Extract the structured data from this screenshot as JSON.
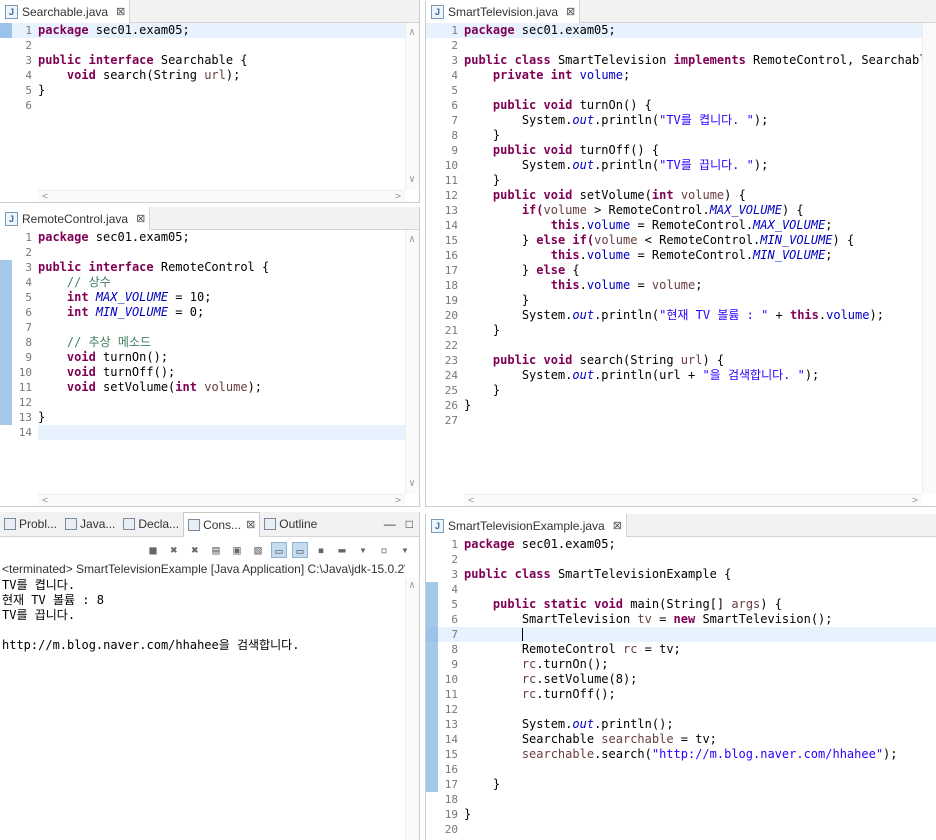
{
  "editors": {
    "searchable": {
      "tab": "Searchable.java",
      "lines": [
        "1",
        "2",
        "3",
        "4",
        "5",
        "6"
      ]
    },
    "remote": {
      "tab": "RemoteControl.java",
      "lines": [
        "1",
        "2",
        "3",
        "4",
        "5",
        "6",
        "7",
        "8",
        "9",
        "10",
        "11",
        "12",
        "13",
        "14"
      ]
    },
    "smarttv": {
      "tab": "SmartTelevision.java",
      "lines": [
        "1",
        "2",
        "3",
        "4",
        "5",
        "6",
        "7",
        "8",
        "9",
        "10",
        "11",
        "12",
        "13",
        "14",
        "15",
        "16",
        "17",
        "18",
        "19",
        "20",
        "21",
        "22",
        "23",
        "24",
        "25",
        "26",
        "27"
      ]
    },
    "example": {
      "tab": "SmartTelevisionExample.java",
      "lines": [
        "1",
        "2",
        "3",
        "4",
        "5",
        "6",
        "7",
        "8",
        "9",
        "10",
        "11",
        "12",
        "13",
        "14",
        "15",
        "16",
        "17",
        "18",
        "19",
        "20"
      ]
    }
  },
  "code": {
    "pkg": "package",
    "pkgname": " sec01.exam05;",
    "s3a": "public",
    "s3b": " ",
    "s3c": "interface",
    "s3d": " Searchable {",
    "s4a": "    ",
    "s4b": "void",
    "s4c": " search(String ",
    "s4d": "url",
    "s4e": ");",
    "s5": "}",
    "r3c": " RemoteControl {",
    "r4": "    // 상수",
    "r5a": "int",
    "r5b": "MAX_VOLUME",
    "r5c": " = 10;",
    "r6b": "MIN_VOLUME",
    "r6c": " = 0;",
    "r8": "    // 추상 메소드",
    "r9b": " turnOn();",
    "r10b": " turnOff();",
    "r11b": " setVolume(",
    "r11c": "volume",
    "r11d": ");",
    "t3b": "class",
    "t3c": " SmartTelevision ",
    "t3d": "implements",
    "t3e": " RemoteControl, Searchable {",
    "t4a": "private",
    "t4b": "int",
    "t4c": "volume",
    "t6b": "void",
    "t6c": " turnOn() {",
    "t7a": "System.",
    "t7b": "out",
    "t7c": ".println(",
    "t7d": "\"TV를 켭니다. \"",
    "t7e": ");",
    "t9c": " turnOff() {",
    "t10d": "\"TV를 끕니다. \"",
    "t12c": " setVolume(",
    "t12e": ") {",
    "t13a": "if(",
    "t13c": " > RemoteControl.",
    "t13e": ") {",
    "t14a": "this",
    "t14c": " = RemoteControl.",
    "t14e": ";",
    "t15a": "} ",
    "t15b": "else",
    "t15d": " < RemoteControl.",
    "t17b": " {",
    "t18d": ";",
    "t20d": "\"현재 TV 볼륨 : \"",
    "t20e": " + ",
    "t20h": ");",
    "t23c": " search(String ",
    "t24c": ".println(url + ",
    "t24d": "\"을 검색합니다. \"",
    "e3c": " SmartTelevisionExample {",
    "e5a": "static",
    "e5c": " main(String[] ",
    "e5d": "args",
    "e5e": ") {",
    "e6a": "SmartTelevision ",
    "e6b": "tv",
    "e6c": " = ",
    "e6d": "new",
    "e6e": " SmartTelevision();",
    "e8a": "RemoteControl ",
    "e8b": "rc",
    "e8c": " = tv;",
    "e9": ".turnOn();",
    "e10": ".setVolume(8);",
    "e11": ".turnOff();",
    "e13": ".println();",
    "e14a": "Searchable ",
    "e14b": "searchable",
    "e14c": " = tv;",
    "e15a": "searchable",
    "e15b": ".search(",
    "e15c": "\"http://m.blog.naver.com/hhahee\"",
    "e15d": ");",
    "brace": "}"
  },
  "console": {
    "tabs": [
      "Probl...",
      "Java...",
      "Decla...",
      "Cons...",
      "Outline"
    ],
    "status": "<terminated> SmartTelevisionExample [Java Application] C:\\Java\\jdk-15.0.2\\",
    "output": [
      "TV를 켭니다.",
      "현재 TV 볼륨 : 8",
      "TV를 끕니다.",
      "",
      "http://m.blog.naver.com/hhahee을 검색합니다."
    ]
  }
}
